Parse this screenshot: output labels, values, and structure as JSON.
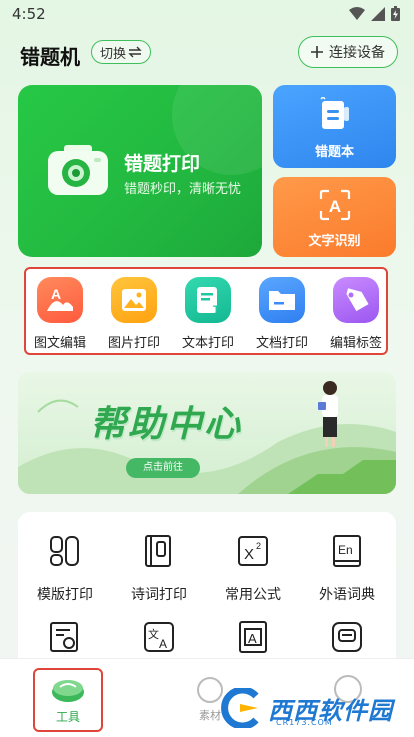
{
  "status": {
    "time": "4:52"
  },
  "header": {
    "title": "错题机",
    "switch_label": "切换",
    "switch_icon": "swap-icon",
    "connect_label": "连接设备",
    "connect_icon": "plus-icon"
  },
  "cards": {
    "print": {
      "title": "错题打印",
      "subtitle": "错题秒印，清晰无忧",
      "icon": "camera-icon"
    },
    "book": {
      "label": "错题本",
      "icon": "book-icon"
    },
    "ocr": {
      "label": "文字识别",
      "icon": "text-scan-icon"
    }
  },
  "tools": [
    {
      "label": "图文编辑",
      "icon": "image-text-edit-icon",
      "color": "#ff6a4d"
    },
    {
      "label": "图片打印",
      "icon": "picture-icon",
      "color": "#ffb21e"
    },
    {
      "label": "文本打印",
      "icon": "text-doc-icon",
      "color": "#20c7a0"
    },
    {
      "label": "文档打印",
      "icon": "folder-icon",
      "color": "#3b8cf5"
    },
    {
      "label": "编辑标签",
      "icon": "tag-icon",
      "color": "#b56cf6"
    }
  ],
  "banner": {
    "title": "帮助中心",
    "button": "点击前往"
  },
  "grid": [
    {
      "label": "模版打印",
      "icon": "template-icon"
    },
    {
      "label": "诗词打印",
      "icon": "poem-book-icon"
    },
    {
      "label": "常用公式",
      "icon": "formula-icon"
    },
    {
      "label": "外语词典",
      "icon": "dictionary-icon"
    },
    {
      "label": "",
      "icon": "search-doc-icon"
    },
    {
      "label": "",
      "icon": "translate-icon"
    },
    {
      "label": "",
      "icon": "letter-a-icon"
    },
    {
      "label": "",
      "icon": "message-icon"
    }
  ],
  "tabbar": {
    "tools_label": "工具",
    "materials_label": "素材"
  },
  "watermark": {
    "text": "西西软件园",
    "sub": "CR173.COM"
  },
  "colors": {
    "accent": "#2fbf4f",
    "highlight_border": "#e0453a"
  }
}
